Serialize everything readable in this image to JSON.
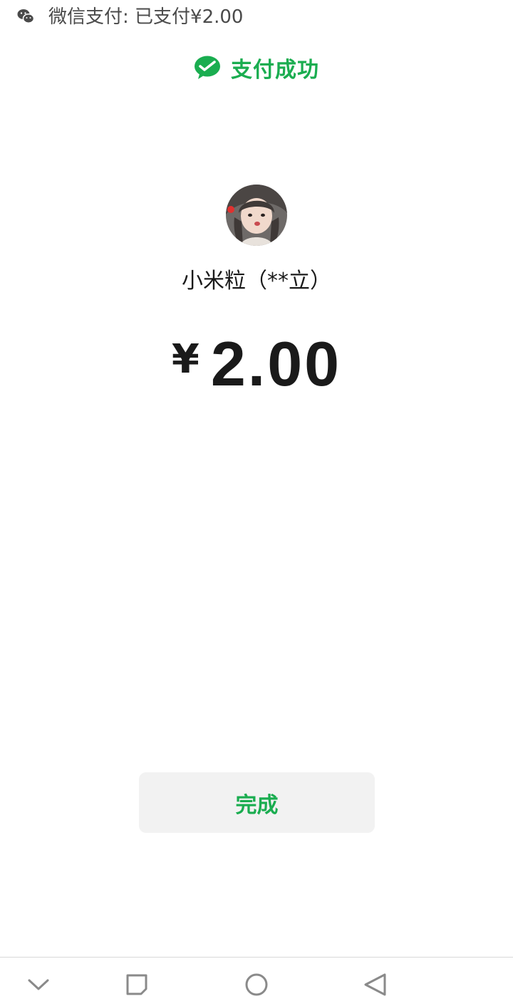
{
  "notification": {
    "icon": "wechat-icon",
    "text": "微信支付: 已支付¥2.00"
  },
  "header": {
    "icon": "wechat-pay-check-icon",
    "title": "支付成功"
  },
  "payee": {
    "avatar": "avatar",
    "name": "小米粒（**立）"
  },
  "amount": {
    "currency": "¥",
    "value": "2.00"
  },
  "actions": {
    "done_label": "完成"
  },
  "nav": {
    "items": [
      "chevron-down-icon",
      "square-icon",
      "circle-icon",
      "triangle-back-icon"
    ]
  },
  "colors": {
    "accent": "#1aad50",
    "button_bg": "#f2f2f2",
    "text": "#1a1a1a"
  }
}
